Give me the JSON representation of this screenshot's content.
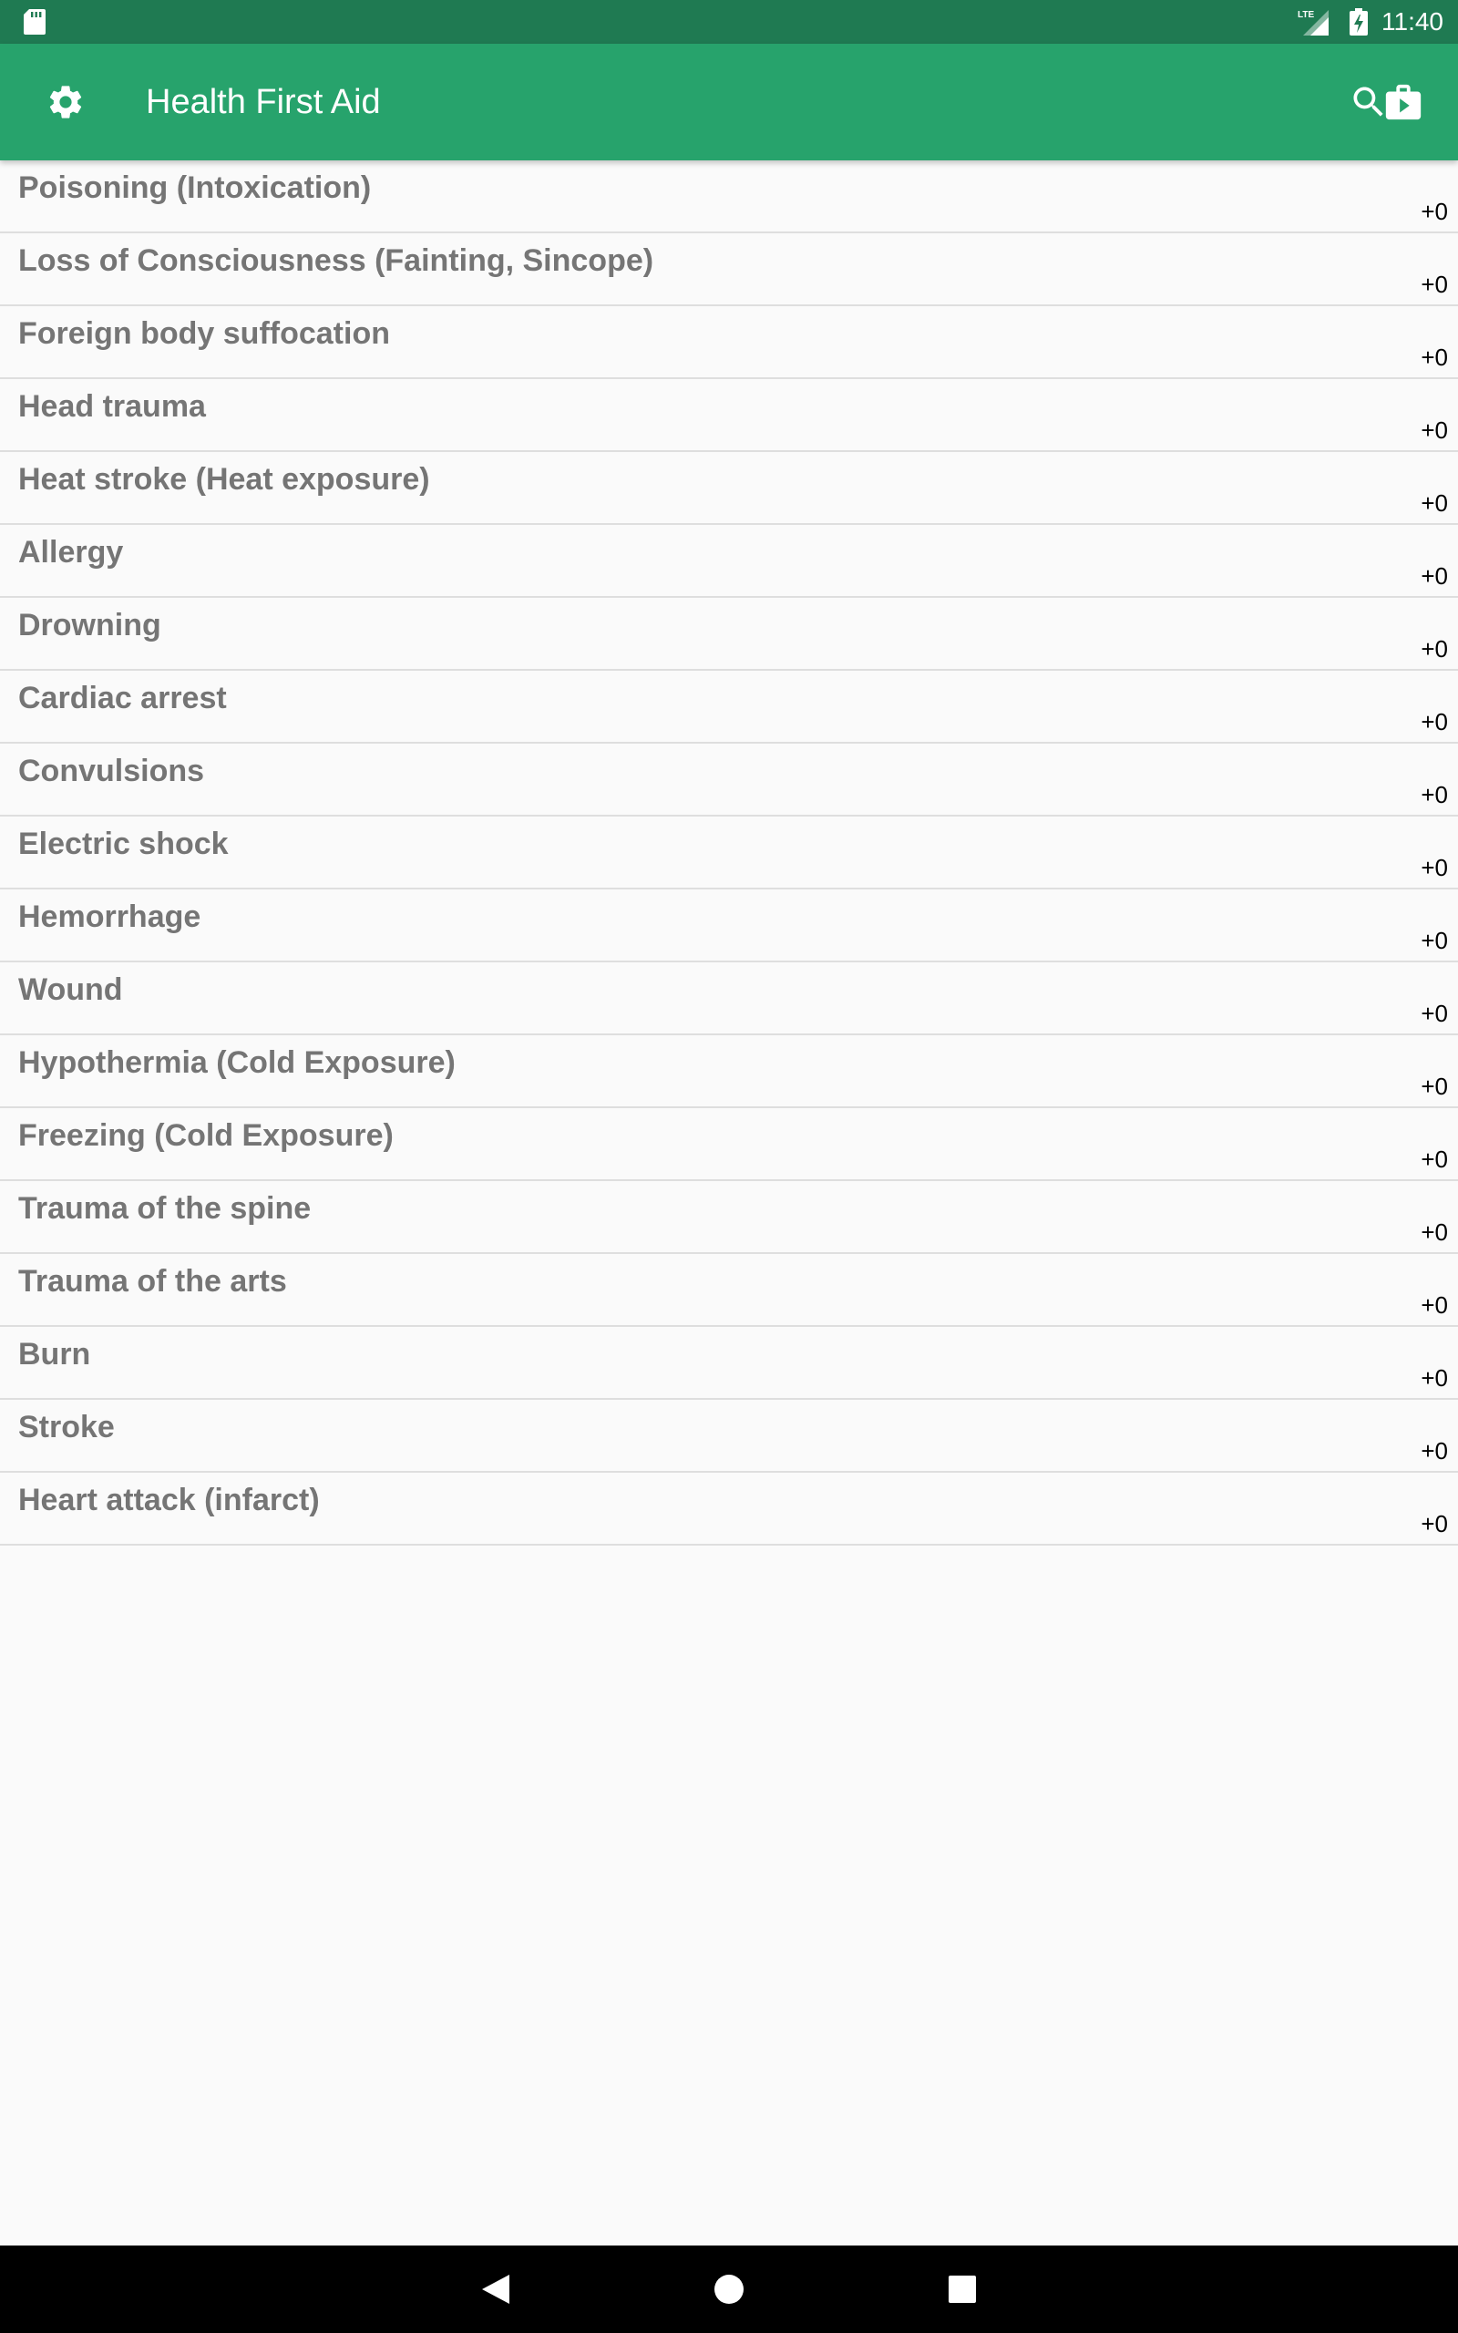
{
  "status_bar": {
    "time": "11:40",
    "icons": [
      "sd-card-icon",
      "lte-signal-icon",
      "battery-charging-icon"
    ],
    "background": "#1f7a52"
  },
  "app_bar": {
    "title": "Health First Aid",
    "background": "#27a36c",
    "icons": [
      "gear-icon",
      "search-icon",
      "first-aid-kit-icon"
    ]
  },
  "list": {
    "items": [
      {
        "title": "Poisoning (Intoxication)",
        "count": "+0"
      },
      {
        "title": "Loss of Consciousness (Fainting, Sincope)",
        "count": "+0"
      },
      {
        "title": "Foreign body suffocation",
        "count": "+0"
      },
      {
        "title": "Head trauma",
        "count": "+0"
      },
      {
        "title": "Heat stroke (Heat exposure)",
        "count": "+0"
      },
      {
        "title": "Allergy",
        "count": "+0"
      },
      {
        "title": "Drowning",
        "count": "+0"
      },
      {
        "title": "Cardiac arrest",
        "count": "+0"
      },
      {
        "title": "Convulsions",
        "count": "+0"
      },
      {
        "title": "Electric shock",
        "count": "+0"
      },
      {
        "title": "Hemorrhage",
        "count": "+0"
      },
      {
        "title": "Wound",
        "count": "+0"
      },
      {
        "title": "Hypothermia (Cold Exposure)",
        "count": "+0"
      },
      {
        "title": "Freezing (Cold Exposure)",
        "count": "+0"
      },
      {
        "title": "Trauma of the spine",
        "count": "+0"
      },
      {
        "title": "Trauma of the arts",
        "count": "+0"
      },
      {
        "title": "Burn",
        "count": "+0"
      },
      {
        "title": "Stroke",
        "count": "+0"
      },
      {
        "title": "Heart attack (infarct)",
        "count": "+0"
      }
    ]
  },
  "nav_bar": {
    "icons": [
      "back-icon",
      "home-icon",
      "recents-icon"
    ]
  }
}
